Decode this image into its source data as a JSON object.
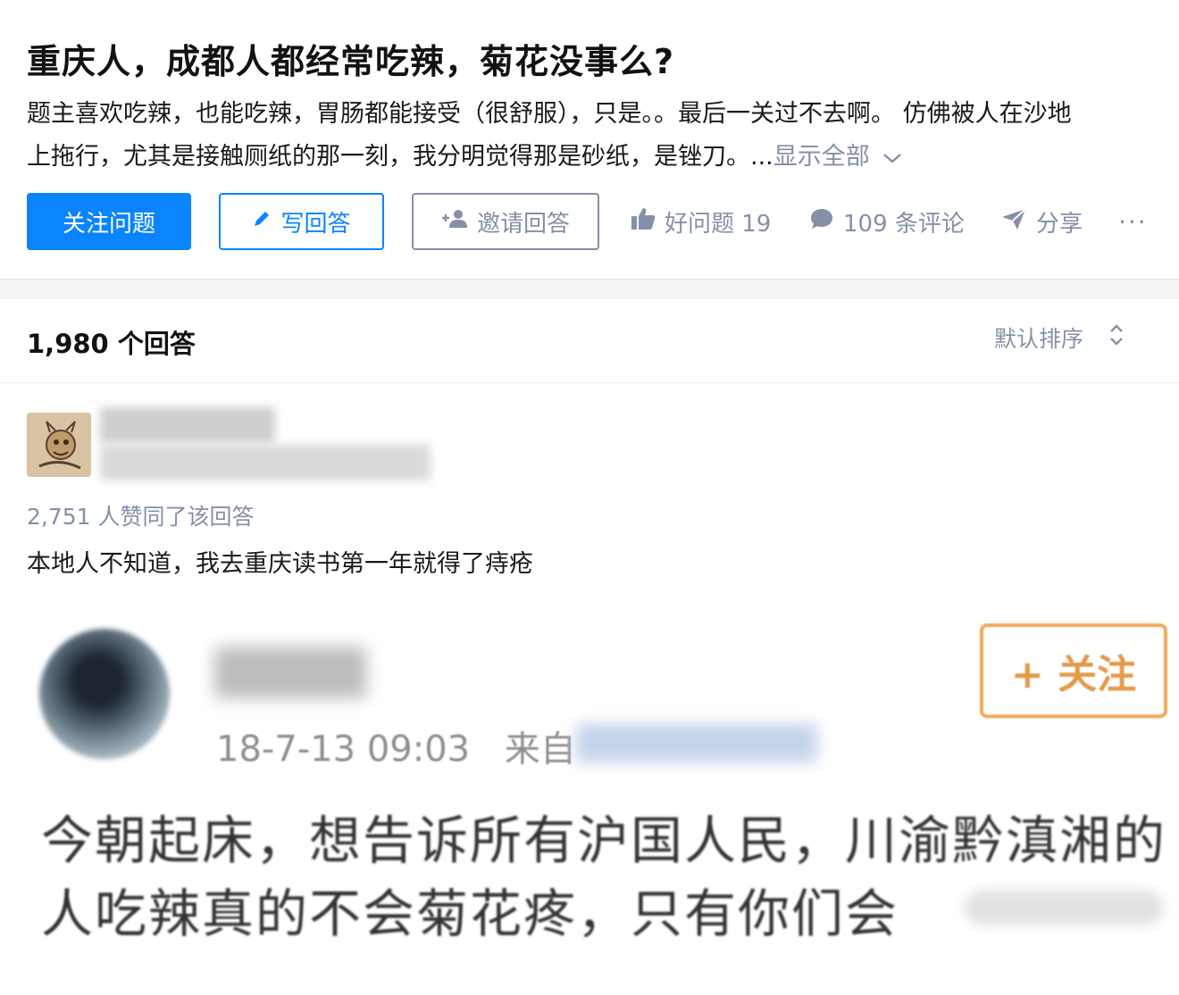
{
  "question": {
    "title": "重庆人，成都人都经常吃辣，菊花没事么?",
    "detail_line1": "题主喜欢吃辣，也能吃辣，胃肠都能接受（很舒服），只是。。最后一关过不去啊。 仿佛被人在沙地",
    "detail_line2_prefix": "上拖行，尤其是接触厕纸的那一刻，我分明觉得那是砂纸，是锉刀。...",
    "show_all": "显示全部",
    "chevron_icon": "chevron-down-icon"
  },
  "actions": {
    "follow_question": "关注问题",
    "write_answer": "写回答",
    "invite_answer": "邀请回答",
    "good_question": "好问题 19",
    "comments": "109 条评论",
    "share": "分享",
    "more": "···"
  },
  "answers_header": {
    "count": "1,980 个回答",
    "sort": "默认排序"
  },
  "answer": {
    "votes": "2,751 人赞同了该回答",
    "excerpt": "本地人不知道，我去重庆读书第一年就得了痔疮"
  },
  "embedded_post": {
    "follow_button": "+ 关注",
    "timestamp": "18-7-13 09:03",
    "source_prefix": "来自",
    "text_line1": "今朝起床，想告诉所有沪国人民，川渝黔滇湘的",
    "text_line2": "人吃辣真的不会菊花疼，只有你们会"
  },
  "colors": {
    "accent": "#0a84ff",
    "meta_gray": "#8590a6",
    "follow_orange": "#f0a95a"
  }
}
